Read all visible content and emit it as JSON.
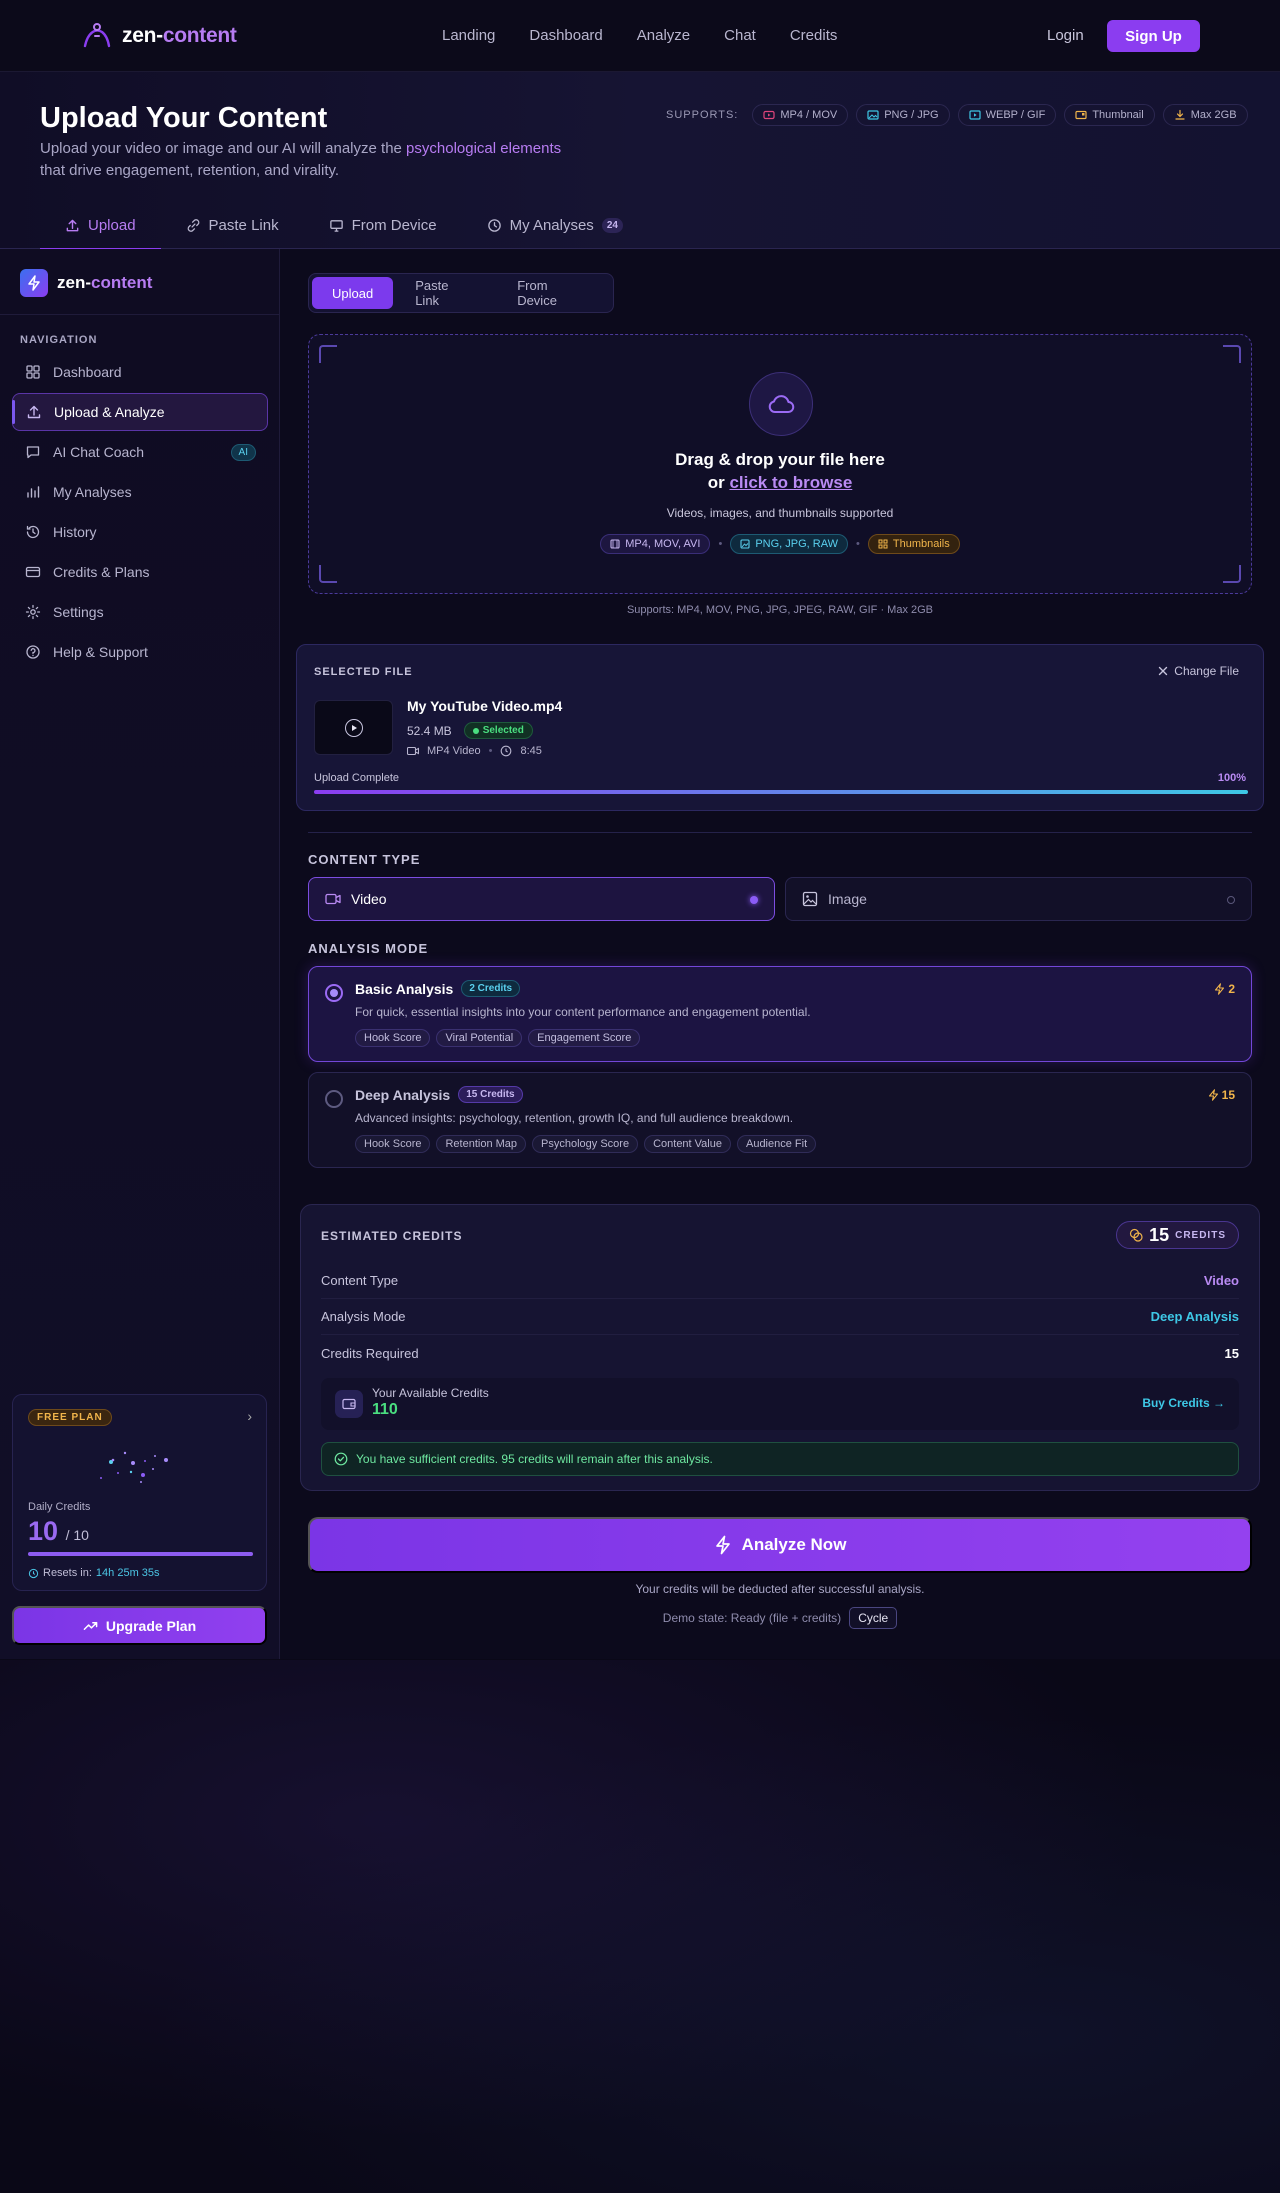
{
  "colors": {
    "accent": "#8b3df0",
    "accent_light": "#b77cf2",
    "cyan": "#3ec8e6",
    "green": "#4ade80",
    "orange": "#f1b54b",
    "background": "#0a0817"
  },
  "topnav": {
    "logo_prefix": "zen-",
    "logo_suffix": "content",
    "links": [
      "Landing",
      "Dashboard",
      "Analyze",
      "Chat",
      "Credits"
    ],
    "login": "Login",
    "signup": "Sign Up"
  },
  "hero": {
    "title": "Upload Your Content",
    "desc_before": "Upload your video or image and our AI will analyze the ",
    "desc_highlight": "psychological elements",
    "desc_after": " that drive engagement, retention, and virality.",
    "supports_label": "SUPPORTS:",
    "supports": [
      {
        "label": "MP4 / MOV",
        "icon": "video-icon",
        "color": "#e0457b"
      },
      {
        "label": "PNG / JPG",
        "icon": "image-icon",
        "color": "#3ec8e6"
      },
      {
        "label": "WEBP / GIF",
        "icon": "play-icon",
        "color": "#3ec8e6"
      },
      {
        "label": "Thumbnail",
        "icon": "thumbnail-icon",
        "color": "#f1b54b"
      },
      {
        "label": "Max 2GB",
        "icon": "download-icon",
        "color": "#f1b54b"
      }
    ],
    "tabs": [
      {
        "label": "Upload",
        "icon": "upload-icon"
      },
      {
        "label": "Paste Link",
        "icon": "link-icon"
      },
      {
        "label": "From Device",
        "icon": "monitor-icon"
      },
      {
        "label": "My Analyses",
        "icon": "clock-icon",
        "count": "24"
      }
    ]
  },
  "sidebar": {
    "logo_prefix": "zen-",
    "logo_suffix": "content",
    "heading": "NAVIGATION",
    "items": [
      {
        "label": "Dashboard",
        "icon": "grid-icon"
      },
      {
        "label": "Upload & Analyze",
        "icon": "upload-icon"
      },
      {
        "label": "AI Chat Coach",
        "icon": "chat-icon",
        "badge": "AI"
      },
      {
        "label": "My Analyses",
        "icon": "bar-chart-icon"
      },
      {
        "label": "History",
        "icon": "history-icon"
      },
      {
        "label": "Credits & Plans",
        "icon": "card-icon"
      },
      {
        "label": "Settings",
        "icon": "gear-icon"
      },
      {
        "label": "Help & Support",
        "icon": "help-icon"
      }
    ],
    "plan": {
      "badge": "FREE PLAN",
      "daily_label": "Daily Credits",
      "daily_value": "10",
      "daily_max": "/ 10",
      "daily_fraction": 1.0,
      "resets_label": "Resets in:",
      "resets_time": "14h 25m 35s"
    },
    "upgrade": "Upgrade Plan"
  },
  "main": {
    "segments": [
      "Upload",
      "Paste Link",
      "From Device"
    ],
    "dropzone": {
      "title_line1": "Drag & drop your file here",
      "title_or": "or ",
      "browse": "click to browse",
      "subtitle": "Videos, images, and thumbnails supported",
      "chips": [
        "MP4, MOV, AVI",
        "PNG, JPG, RAW",
        "Thumbnails"
      ],
      "footer": "Supports: MP4, MOV, PNG, JPG, JPEG, RAW, GIF  ·  Max 2GB"
    },
    "selected_file": {
      "label": "SELECTED FILE",
      "change": "Change File",
      "name": "My YouTube Video.mp4",
      "size": "52.4 MB",
      "status": "Selected",
      "type": "MP4 Video",
      "duration": "8:45",
      "upload_label": "Upload Complete",
      "upload_pct": "100%",
      "upload_fraction": 1.0
    },
    "content_type": {
      "label": "CONTENT TYPE",
      "options": [
        "Video",
        "Image"
      ],
      "selected": "Video"
    },
    "analysis_mode": {
      "label": "ANALYSIS MODE",
      "modes": [
        {
          "title": "Basic Analysis",
          "credits_tag": "2 Credits",
          "cost": "2",
          "desc": "For quick, essential insights into your content performance and engagement potential.",
          "tags": [
            "Hook Score",
            "Viral Potential",
            "Engagement Score"
          ]
        },
        {
          "title": "Deep Analysis",
          "credits_tag": "15 Credits",
          "cost": "15",
          "desc": "Advanced insights: psychology, retention, growth IQ, and full audience breakdown.",
          "tags": [
            "Hook Score",
            "Retention Map",
            "Psychology Score",
            "Content Value",
            "Audience Fit"
          ]
        }
      ]
    },
    "credits": {
      "label": "ESTIMATED CREDITS",
      "total": "15",
      "unit": "CREDITS",
      "rows": [
        {
          "label": "Content Type",
          "value": "Video",
          "color": "#b98af3"
        },
        {
          "label": "Analysis Mode",
          "value": "Deep Analysis",
          "color": "#3ec8e6"
        },
        {
          "label": "Credits Required",
          "value": "15",
          "color": "#ffffff"
        }
      ],
      "available_label": "Your Available Credits",
      "available_value": "110",
      "buy": "Buy Credits →",
      "sufficient": "You have sufficient credits. 95 credits will remain after this analysis."
    },
    "analyze_button": "Analyze Now",
    "deduct_note": "Your credits will be deducted after successful analysis.",
    "demo_state": "Demo state: Ready (file + credits)",
    "cycle": "Cycle"
  }
}
